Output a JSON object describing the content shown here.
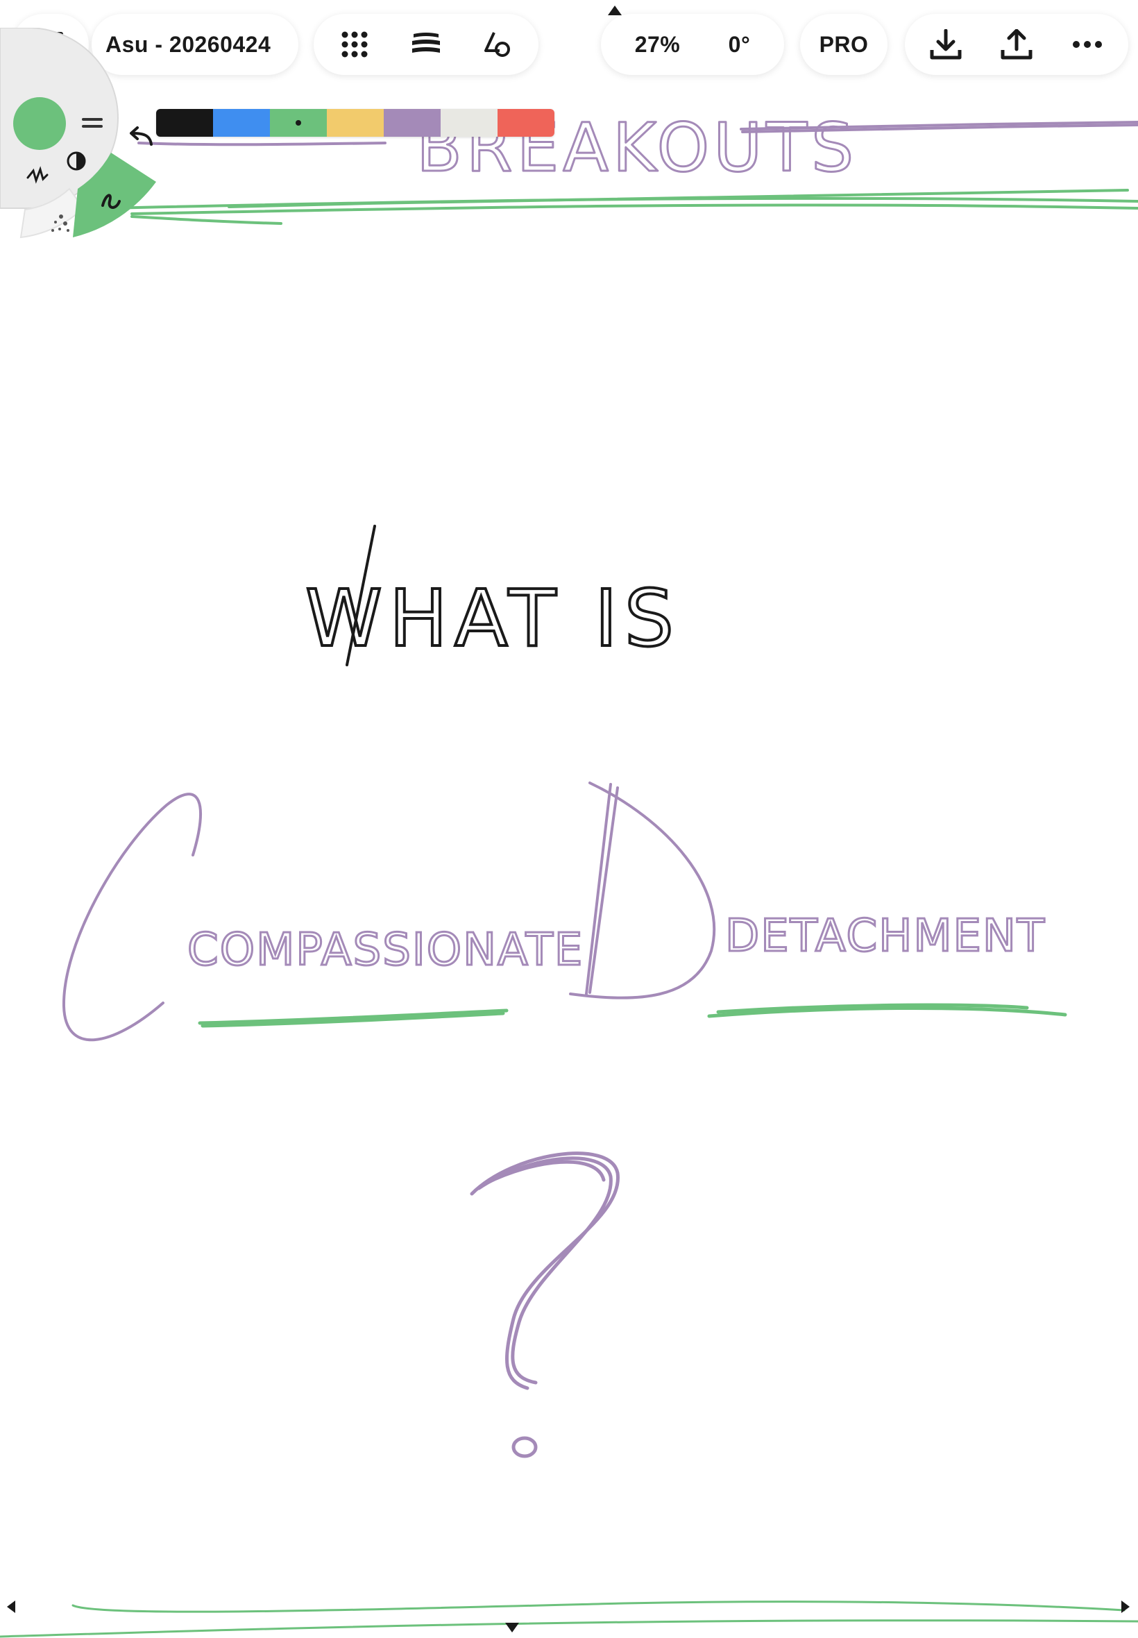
{
  "app": {
    "document_title": "Asu - 20260424"
  },
  "toolbar": {
    "zoom": "27%",
    "rotation": "0°",
    "pro_label": "PRO"
  },
  "colors": {
    "ink_black": "#1a1a1a",
    "ink_purple": "#a48ab8",
    "ink_green": "#6cc17c",
    "selected_brush": "#6cc17c"
  },
  "palette": [
    {
      "name": "black",
      "hex": "#171717"
    },
    {
      "name": "blue",
      "hex": "#3f8ef0"
    },
    {
      "name": "green",
      "hex": "#6cc17c",
      "selected": true
    },
    {
      "name": "yellow",
      "hex": "#f2cb6c"
    },
    {
      "name": "purple",
      "hex": "#a48ab8"
    },
    {
      "name": "light-gray",
      "hex": "#e8e8e3"
    },
    {
      "name": "red",
      "hex": "#ef6459"
    }
  ],
  "canvas_text": {
    "heading": "BREAKOUTS",
    "question_line1": "WHAT IS",
    "term_part1": "COMPASSIONATE",
    "term_part2": "DETACHMENT",
    "mark": "?"
  },
  "icons": {
    "gallery": "grid-icon",
    "grid_dots": "dots-grid-icon",
    "layers": "layers-icon",
    "shapes": "shapes-icon",
    "download": "download-icon",
    "upload": "upload-icon",
    "more": "more-icon",
    "undo": "undo-icon"
  }
}
